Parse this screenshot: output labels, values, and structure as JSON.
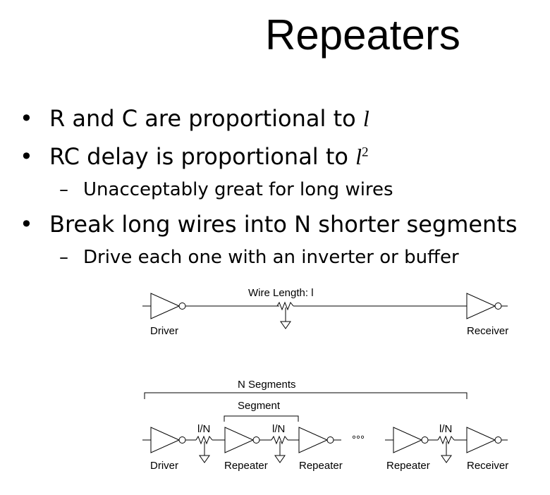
{
  "slide": {
    "title": "Repeaters",
    "bullets": [
      {
        "text": "R and C are proportional to ",
        "var": "l"
      },
      {
        "text": "RC delay is proportional to ",
        "var": "l",
        "sup": "2"
      },
      {
        "sub": "Unacceptably great for long wires"
      },
      {
        "text": "Break long wires into N shorter segments"
      },
      {
        "sub": "Drive each one with an inverter or buffer"
      }
    ]
  },
  "diagram": {
    "top": {
      "wire_label": "Wire Length: l",
      "driver": "Driver",
      "receiver": "Receiver"
    },
    "bottom": {
      "n_segments": "N Segments",
      "segment": "Segment",
      "seg_res_label": "l/N",
      "ellipsis": "°°°",
      "driver": "Driver",
      "repeater": "Repeater",
      "receiver": "Receiver"
    }
  }
}
